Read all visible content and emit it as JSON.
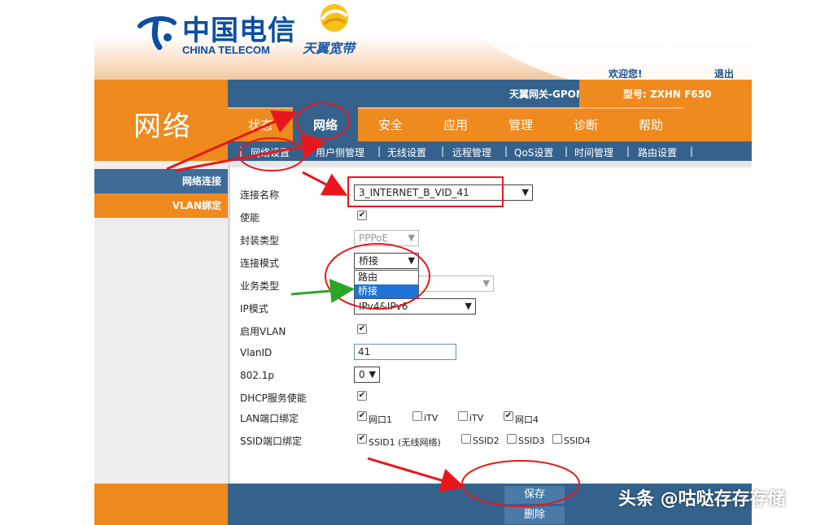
{
  "header": {
    "ct_logo_cn": "中国电信",
    "ct_logo_en": "CHINA TELECOM",
    "ty_logo": "天翼宽带",
    "welcome": "欢迎您!",
    "logout": "退出"
  },
  "info_bar": {
    "gateway_name": "天翼网关-GPON",
    "model": "型号: ZXHN F650"
  },
  "section_title": "网络",
  "tabs": [
    {
      "label": "状态"
    },
    {
      "label": "网络"
    },
    {
      "label": "安全"
    },
    {
      "label": "应用"
    },
    {
      "label": "管理"
    },
    {
      "label": "诊断"
    },
    {
      "label": "帮助"
    }
  ],
  "subnav": [
    {
      "label": "网络设置"
    },
    {
      "label": "用户侧管理"
    },
    {
      "label": "无线设置"
    },
    {
      "label": "远程管理"
    },
    {
      "label": "QoS设置"
    },
    {
      "label": "时间管理"
    },
    {
      "label": "路由设置"
    }
  ],
  "left_nav": {
    "conn": "网络连接",
    "vlan": "VLAN绑定"
  },
  "form": {
    "conn_name_label": "连接名称",
    "conn_name_value": "3_INTERNET_B_VID_41",
    "enable_label": "使能",
    "encap_label": "封装类型",
    "encap_value": "PPPoE",
    "mode_label": "连接模式",
    "mode_value": "桥接",
    "mode_options": [
      "路由",
      "桥接"
    ],
    "service_label": "业务类型",
    "ipmode_label": "IP模式",
    "ipmode_value": "IPv4&IPv6",
    "vlan_enable_label": "启用VLAN",
    "vlanid_label": "VlanID",
    "vlanid_value": "41",
    "p8021_label": "802.1p",
    "p8021_value": "0",
    "dhcp_label": "DHCP服务使能",
    "lan_bind_label": "LAN端口绑定",
    "lan_ports": [
      {
        "label": "网口1",
        "checked": true
      },
      {
        "label": "iTV",
        "checked": false
      },
      {
        "label": "iTV",
        "checked": false
      },
      {
        "label": "网口4",
        "checked": true
      }
    ],
    "ssid_bind_label": "SSID端口绑定",
    "ssids": [
      {
        "label": "SSID1 (无线网络)",
        "checked": true
      },
      {
        "label": "SSID2",
        "checked": false
      },
      {
        "label": "SSID3",
        "checked": false
      },
      {
        "label": "SSID4",
        "checked": false
      }
    ]
  },
  "footer": {
    "save": "保存",
    "delete": "删除"
  },
  "watermark": "头条 @咕哒存存存储",
  "colors": {
    "orange": "#ee8a1e",
    "blue": "#35628c",
    "annotation_red": "#e8171d",
    "annotation_green": "#2aa52a"
  },
  "icons": {
    "checkmark": "✔",
    "dropdown_arrow": "⌄"
  }
}
